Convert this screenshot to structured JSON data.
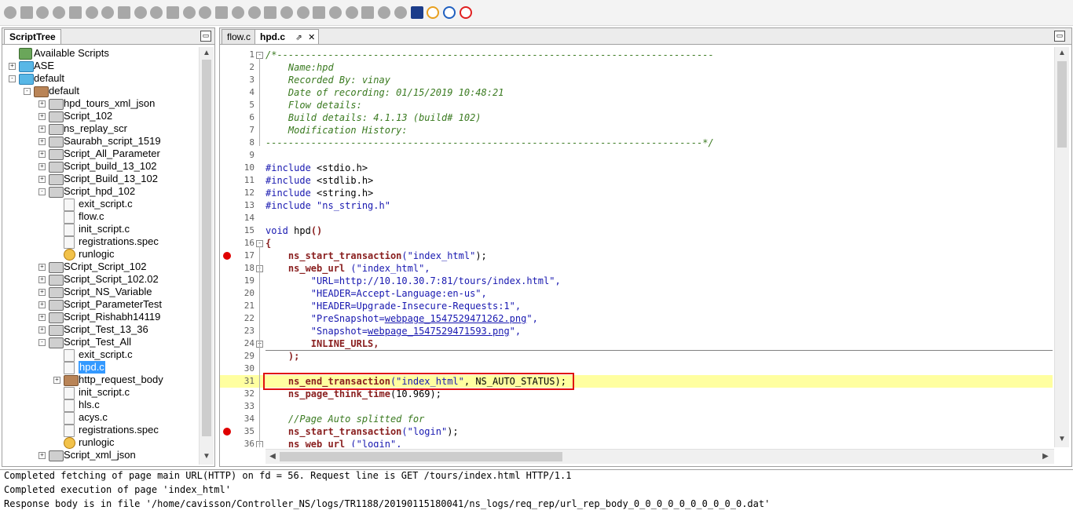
{
  "toolbar": {
    "icons": [
      "circle-icon",
      "circle-icon",
      "no-entry-icon",
      "pause-icon",
      "play-icon",
      "comment-icon",
      "flag-icon",
      "square-icon",
      "copy-icon",
      "paste-icon",
      "download-icon",
      "upload-icon",
      "refresh-icon",
      "bookmark-icon",
      "globe-icon",
      "gear-icon",
      "edit-icon",
      "dot-icon",
      "page-icon",
      "page-icon",
      "page-icon",
      "image-icon",
      "settings-icon",
      "export-icon",
      "mail-icon",
      "save-icon",
      "reload-icon",
      "forward-icon",
      "stop-icon"
    ]
  },
  "left_panel": {
    "tab_label": "ScriptTree",
    "tree": [
      {
        "label": "Available Scripts",
        "icon": "root",
        "depth": 0,
        "exp": "none"
      },
      {
        "label": "ASE",
        "icon": "blue",
        "depth": 0,
        "exp": "+"
      },
      {
        "label": "default",
        "icon": "blue",
        "depth": 0,
        "exp": "-"
      },
      {
        "label": "default",
        "icon": "brown",
        "depth": 1,
        "exp": "-"
      },
      {
        "label": "hpd_tours_xml_json",
        "icon": "grey",
        "depth": 2,
        "exp": "+"
      },
      {
        "label": "Script_102",
        "icon": "grey",
        "depth": 2,
        "exp": "+"
      },
      {
        "label": "ns_replay_scr",
        "icon": "grey",
        "depth": 2,
        "exp": "+"
      },
      {
        "label": "Saurabh_script_1519",
        "icon": "grey",
        "depth": 2,
        "exp": "+"
      },
      {
        "label": "Script_All_Parameter",
        "icon": "grey",
        "depth": 2,
        "exp": "+"
      },
      {
        "label": "Script_build_13_102",
        "icon": "grey",
        "depth": 2,
        "exp": "+"
      },
      {
        "label": "Script_Build_13_102",
        "icon": "grey",
        "depth": 2,
        "exp": "+"
      },
      {
        "label": "Script_hpd_102",
        "icon": "grey",
        "depth": 2,
        "exp": "-"
      },
      {
        "label": "exit_script.c",
        "icon": "file",
        "depth": 3,
        "exp": "none"
      },
      {
        "label": "flow.c",
        "icon": "file",
        "depth": 3,
        "exp": "none"
      },
      {
        "label": "init_script.c",
        "icon": "file",
        "depth": 3,
        "exp": "none"
      },
      {
        "label": "registrations.spec",
        "icon": "file",
        "depth": 3,
        "exp": "none"
      },
      {
        "label": "runlogic",
        "icon": "gear",
        "depth": 3,
        "exp": "none"
      },
      {
        "label": "SCript_Script_102",
        "icon": "grey",
        "depth": 2,
        "exp": "+"
      },
      {
        "label": "Script_Script_102.02",
        "icon": "grey",
        "depth": 2,
        "exp": "+"
      },
      {
        "label": "Script_NS_Variable",
        "icon": "grey",
        "depth": 2,
        "exp": "+"
      },
      {
        "label": "Script_ParameterTest",
        "icon": "grey",
        "depth": 2,
        "exp": "+"
      },
      {
        "label": "Script_Rishabh14119",
        "icon": "grey",
        "depth": 2,
        "exp": "+"
      },
      {
        "label": "Script_Test_13_36",
        "icon": "grey",
        "depth": 2,
        "exp": "+"
      },
      {
        "label": "Script_Test_All",
        "icon": "grey",
        "depth": 2,
        "exp": "-"
      },
      {
        "label": "exit_script.c",
        "icon": "file",
        "depth": 3,
        "exp": "none"
      },
      {
        "label": "hpd.c",
        "icon": "file",
        "depth": 3,
        "exp": "none",
        "selected": true
      },
      {
        "label": "http_request_body",
        "icon": "brown",
        "depth": 3,
        "exp": "+"
      },
      {
        "label": "init_script.c",
        "icon": "file",
        "depth": 3,
        "exp": "none"
      },
      {
        "label": "hls.c",
        "icon": "file",
        "depth": 3,
        "exp": "none"
      },
      {
        "label": "acys.c",
        "icon": "file",
        "depth": 3,
        "exp": "none"
      },
      {
        "label": "registrations.spec",
        "icon": "file",
        "depth": 3,
        "exp": "none"
      },
      {
        "label": "runlogic",
        "icon": "gear",
        "depth": 3,
        "exp": "none"
      },
      {
        "label": "Script_xml_json",
        "icon": "grey",
        "depth": 2,
        "exp": "+"
      }
    ]
  },
  "editor": {
    "tabs": [
      {
        "label": "flow.c",
        "active": false
      },
      {
        "label": "hpd.c",
        "active": true
      }
    ],
    "pin_glyph": "⇗",
    "close_glyph": "✕",
    "lines": [
      {
        "num": "1",
        "fold": "-",
        "parts": [
          {
            "c": "comment",
            "t": "/*-----------------------------------------------------------------------------"
          }
        ]
      },
      {
        "num": "2",
        "parts": [
          {
            "c": "comment",
            "t": "    Name:hpd"
          }
        ]
      },
      {
        "num": "3",
        "parts": [
          {
            "c": "comment",
            "t": "    Recorded By: vinay"
          }
        ]
      },
      {
        "num": "4",
        "parts": [
          {
            "c": "comment",
            "t": "    Date of recording: 01/15/2019 10:48:21"
          }
        ]
      },
      {
        "num": "5",
        "parts": [
          {
            "c": "comment",
            "t": "    Flow details:"
          }
        ]
      },
      {
        "num": "6",
        "parts": [
          {
            "c": "comment",
            "t": "    Build details: 4.1.13 (build# 102)"
          }
        ]
      },
      {
        "num": "7",
        "parts": [
          {
            "c": "comment",
            "t": "    Modification History:"
          }
        ]
      },
      {
        "num": "8",
        "parts": [
          {
            "c": "comment",
            "t": "-----------------------------------------------------------------------------*/"
          }
        ]
      },
      {
        "num": "9",
        "parts": []
      },
      {
        "num": "10",
        "parts": [
          {
            "c": "pre",
            "t": "#include "
          },
          {
            "c": "plain",
            "t": "<stdio.h>"
          }
        ]
      },
      {
        "num": "11",
        "parts": [
          {
            "c": "pre",
            "t": "#include "
          },
          {
            "c": "plain",
            "t": "<stdlib.h>"
          }
        ]
      },
      {
        "num": "12",
        "parts": [
          {
            "c": "pre",
            "t": "#include "
          },
          {
            "c": "plain",
            "t": "<string.h>"
          }
        ]
      },
      {
        "num": "13",
        "parts": [
          {
            "c": "pre",
            "t": "#include "
          },
          {
            "c": "str",
            "t": "\"ns_string.h\""
          }
        ]
      },
      {
        "num": "14",
        "parts": []
      },
      {
        "num": "15",
        "parts": [
          {
            "c": "kw",
            "t": "void "
          },
          {
            "c": "plain",
            "t": "hpd"
          },
          {
            "c": "fn",
            "t": "()"
          }
        ]
      },
      {
        "num": "16",
        "fold": "-",
        "parts": [
          {
            "c": "fn",
            "t": "{"
          }
        ]
      },
      {
        "num": "17",
        "bp": true,
        "parts": [
          {
            "c": "plain",
            "t": "    "
          },
          {
            "c": "fn",
            "t": "ns_start_transaction"
          },
          {
            "c": "str",
            "t": "(\"index_html\""
          },
          {
            "c": "plain",
            "t": ");"
          }
        ]
      },
      {
        "num": "18",
        "fold": "-",
        "parts": [
          {
            "c": "plain",
            "t": "    "
          },
          {
            "c": "fn",
            "t": "ns_web_url"
          },
          {
            "c": "plain",
            "t": " "
          },
          {
            "c": "str",
            "t": "(\"index_html\","
          }
        ]
      },
      {
        "num": "19",
        "parts": [
          {
            "c": "str",
            "t": "        \"URL=http://10.10.30.7:81/tours/index.html\","
          }
        ]
      },
      {
        "num": "20",
        "parts": [
          {
            "c": "str",
            "t": "        \"HEADER=Accept-Language:en-us\","
          }
        ]
      },
      {
        "num": "21",
        "parts": [
          {
            "c": "str",
            "t": "        \"HEADER=Upgrade-Insecure-Requests:1\","
          }
        ]
      },
      {
        "num": "22",
        "parts": [
          {
            "c": "str",
            "t": "        \"PreSnapshot="
          },
          {
            "c": "link",
            "t": "webpage_1547529471262.png"
          },
          {
            "c": "str",
            "t": "\","
          }
        ]
      },
      {
        "num": "23",
        "parts": [
          {
            "c": "str",
            "t": "        \"Snapshot="
          },
          {
            "c": "link",
            "t": "webpage_1547529471593.png"
          },
          {
            "c": "str",
            "t": "\","
          }
        ]
      },
      {
        "num": "24",
        "fold": "+",
        "parts": [
          {
            "c": "fn",
            "t": "        INLINE_URLS,"
          }
        ]
      },
      {
        "num": "29",
        "parts": [
          {
            "c": "plain",
            "t": "    "
          },
          {
            "c": "fn",
            "t": ");"
          }
        ]
      },
      {
        "num": "30",
        "parts": []
      },
      {
        "num": "31",
        "hl": true,
        "parts": [
          {
            "c": "plain",
            "t": "    "
          },
          {
            "c": "fn",
            "t": "ns_end_transaction"
          },
          {
            "c": "str",
            "t": "(\"index_html\""
          },
          {
            "c": "plain",
            "t": ", NS_AUTO_STATUS);"
          }
        ]
      },
      {
        "num": "32",
        "parts": [
          {
            "c": "plain",
            "t": "    "
          },
          {
            "c": "fn",
            "t": "ns_page_think_time"
          },
          {
            "c": "plain",
            "t": "(10.969);"
          }
        ]
      },
      {
        "num": "33",
        "parts": []
      },
      {
        "num": "34",
        "parts": [
          {
            "c": "comment",
            "t": "    //Page Auto splitted for"
          }
        ]
      },
      {
        "num": "35",
        "bp": true,
        "parts": [
          {
            "c": "plain",
            "t": "    "
          },
          {
            "c": "fn",
            "t": "ns_start_transaction"
          },
          {
            "c": "str",
            "t": "(\"login\""
          },
          {
            "c": "plain",
            "t": ");"
          }
        ]
      },
      {
        "num": "36",
        "fold": "-",
        "parts": [
          {
            "c": "plain",
            "t": "    "
          },
          {
            "c": "fn",
            "t": "ns_web_url"
          },
          {
            "c": "plain",
            "t": " "
          },
          {
            "c": "str",
            "t": "(\"login\","
          }
        ]
      }
    ]
  },
  "console": {
    "lines": [
      "Completed fetching of page main URL(HTTP) on fd = 56. Request line is GET /tours/index.html HTTP/1.1",
      "Completed execution of page 'index_html'",
      "Response body is in file '/home/cavisson/Controller_NS/logs/TR1188/20190115180041/ns_logs/req_rep/url_rep_body_0_0_0_0_0_0_0_0_0_0.dat'"
    ]
  }
}
